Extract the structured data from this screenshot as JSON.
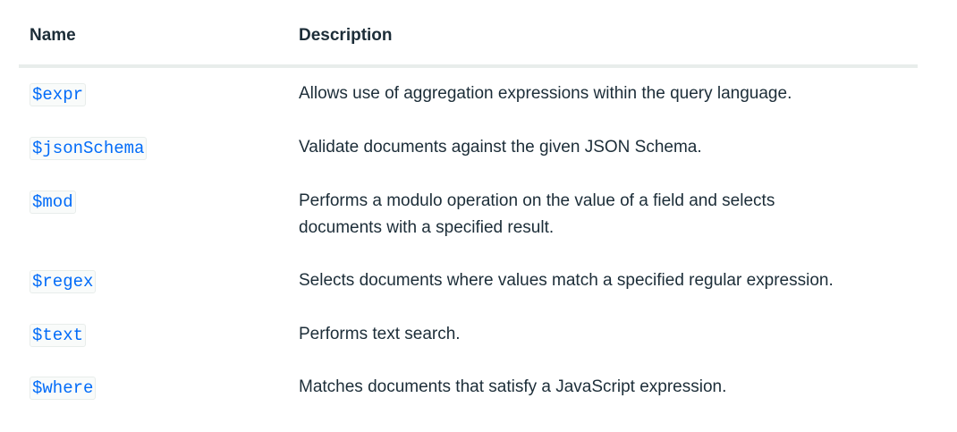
{
  "table": {
    "headers": {
      "name": "Name",
      "description": "Description"
    },
    "rows": [
      {
        "name": "$expr",
        "description": "Allows use of aggregation expressions within the query language."
      },
      {
        "name": "$jsonSchema",
        "description": "Validate documents against the given JSON Schema."
      },
      {
        "name": "$mod",
        "description": "Performs a modulo operation on the value of a field and selects documents with a specified result."
      },
      {
        "name": "$regex",
        "description": "Selects documents where values match a specified regular expression."
      },
      {
        "name": "$text",
        "description": "Performs text search."
      },
      {
        "name": "$where",
        "description": "Matches documents that satisfy a JavaScript expression."
      }
    ]
  },
  "colors": {
    "link": "#016bf8",
    "text": "#1c2d38",
    "divider": "#e8edeb"
  }
}
